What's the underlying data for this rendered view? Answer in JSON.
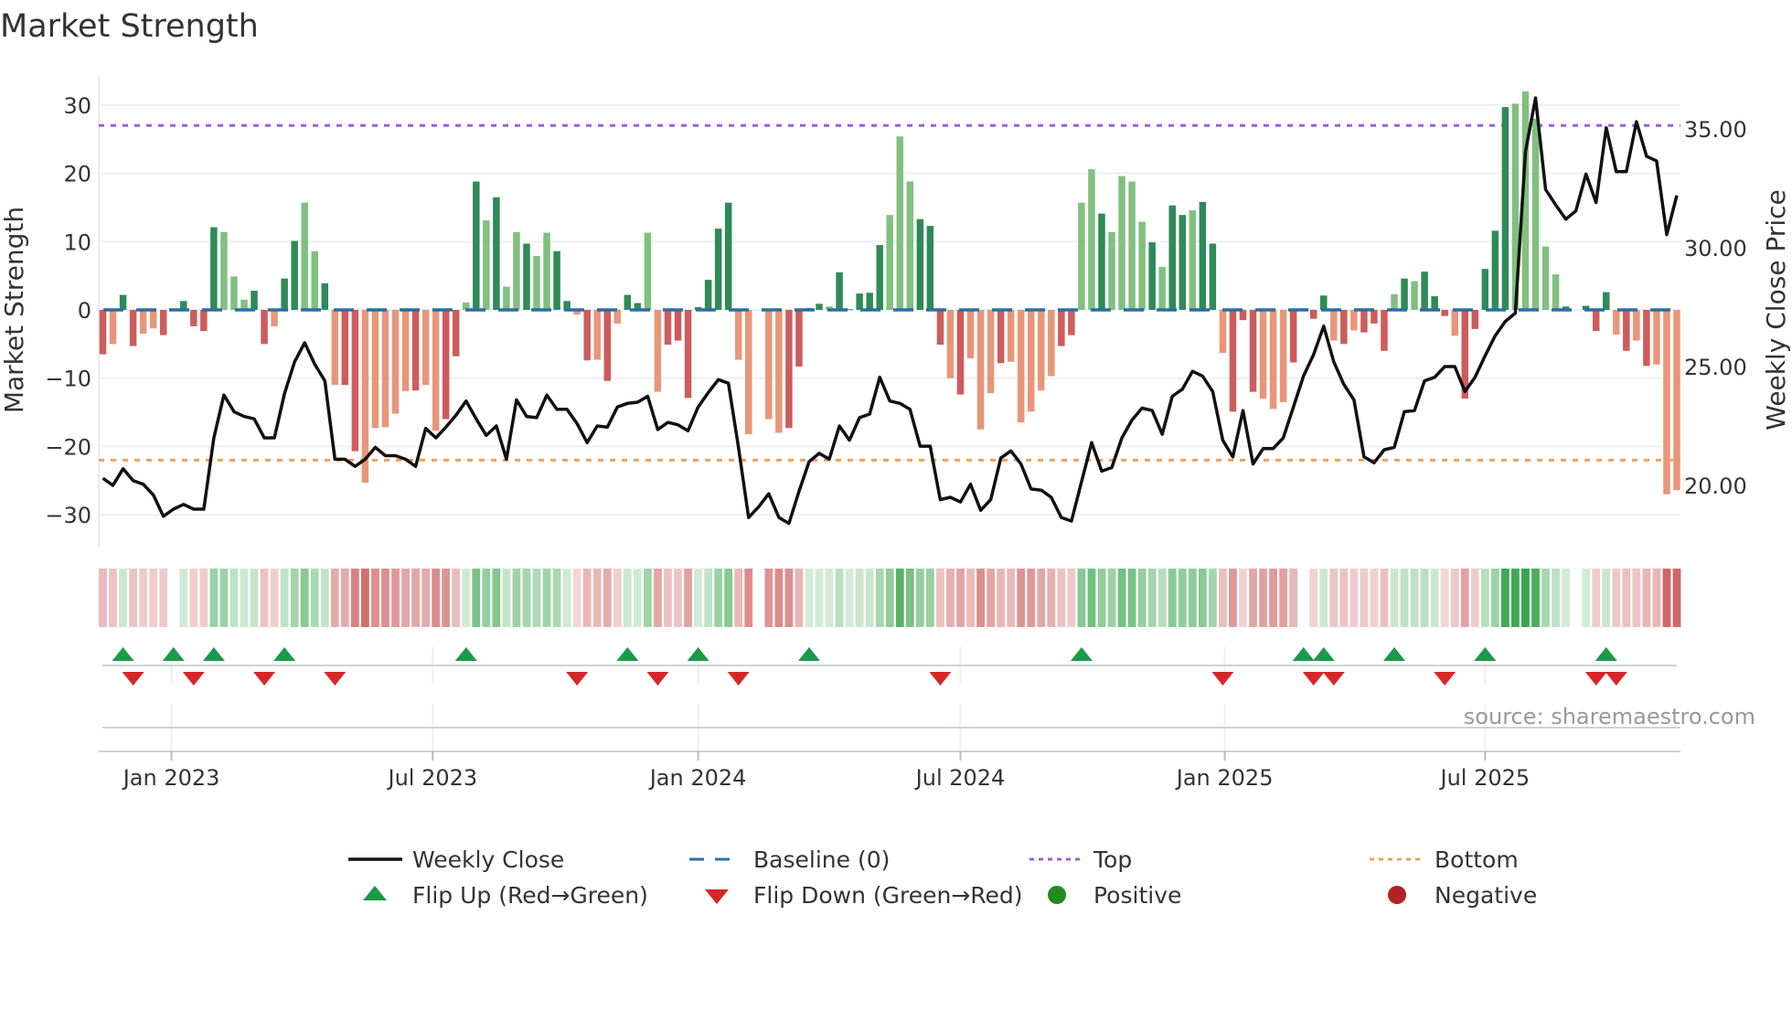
{
  "title": "Market Strength",
  "source": "source: sharemaestro.com",
  "colors": {
    "dark_green": "#2e8b57",
    "light_green": "#81c07f",
    "dark_red": "#cd5c5c",
    "light_red": "#e8967a",
    "line": "#111111",
    "baseline": "#2b6fa3",
    "top": "#9d5ce6",
    "bottom": "#f0a05a",
    "flip_up": "#1a9a4a",
    "flip_down": "#d62728",
    "positive": "#228b22",
    "negative": "#b22222"
  },
  "legend": {
    "weekly_close": "Weekly Close",
    "baseline": "Baseline (0)",
    "top": "Top",
    "bottom": "Bottom",
    "flip_up": "Flip Up (Red→Green)",
    "flip_down": "Flip Down (Green→Red)",
    "positive": "Positive",
    "negative": "Negative"
  },
  "chart_data": {
    "type": "bar",
    "title": "Market Strength",
    "ylabel": "Market Strength",
    "y2label": "Weekly Close Price",
    "ylim": [
      -35,
      35
    ],
    "y2lim": [
      17.9,
      36.9
    ],
    "yticks": [
      "30",
      "20",
      "10",
      "0",
      "−10",
      "−20",
      "−30"
    ],
    "ytick_values": [
      30,
      20,
      10,
      0,
      -10,
      -20,
      -30
    ],
    "y2ticks": [
      "35.00",
      "30.00",
      "25.00",
      "20.00"
    ],
    "y2tick_values": [
      35,
      30,
      25,
      20
    ],
    "xticks": [
      {
        "label": "Jan 2023",
        "week": 6.8
      },
      {
        "label": "Jul 2023",
        "week": 32.7
      },
      {
        "label": "Jan 2024",
        "week": 59.0
      },
      {
        "label": "Jul 2024",
        "week": 85.0
      },
      {
        "label": "Jan 2025",
        "week": 111.2
      },
      {
        "label": "Jul 2025",
        "week": 137.0
      }
    ],
    "top_level": 27,
    "bottom_level": -22,
    "baseline": 0,
    "strength": [
      -6.5,
      -5,
      2.2,
      -5.3,
      -3.5,
      -2.7,
      -3.7,
      0,
      1.3,
      -2.4,
      -3.1,
      12.1,
      11.4,
      4.9,
      1.5,
      2.8,
      -5,
      -2.4,
      4.6,
      10.1,
      15.7,
      8.6,
      3.9,
      -11,
      -11,
      -20.7,
      -25.3,
      -17.3,
      -17.2,
      -15.2,
      -11.9,
      -11.8,
      -11,
      -17.7,
      -16,
      -6.8,
      1.1,
      18.8,
      13.1,
      16.5,
      3.4,
      11.4,
      9.7,
      7.9,
      11.3,
      8.6,
      1.3,
      -0.7,
      -7.4,
      -7.3,
      -10.4,
      -2,
      2.2,
      1,
      11.3,
      -12,
      -5.1,
      -4.5,
      -12.9,
      0.4,
      4.4,
      11.9,
      15.7,
      -7.3,
      -18.2,
      0,
      -16,
      -18,
      -17.3,
      -8.3,
      0.3,
      0.9,
      0.5,
      5.5,
      0.1,
      2.4,
      2.5,
      9.5,
      13.9,
      25.4,
      18.8,
      13.3,
      12.3,
      -5.1,
      -10,
      -12.4,
      -7.1,
      -17.5,
      -12.2,
      -7.8,
      -7.6,
      -16.5,
      -14.9,
      -11.8,
      -9.7,
      -5.3,
      -3.7,
      15.7,
      20.6,
      14.1,
      11.4,
      19.6,
      18.8,
      12.9,
      9.9,
      6.3,
      15.3,
      13.9,
      14.6,
      15.8,
      9.7,
      -6.3,
      -14.9,
      -1.5,
      -12,
      -13,
      -14.5,
      -13.5,
      -7.7,
      0,
      -1.3,
      2.1,
      -4.5,
      -5,
      -3,
      -3.3,
      -2,
      -6,
      2.3,
      4.6,
      4.2,
      5.6,
      2,
      -0.9,
      -3.8,
      -13,
      -2.8,
      6,
      11.6,
      29.7,
      30.2,
      32,
      28,
      9.3,
      5.2,
      0.5,
      0,
      0.6,
      -3.1,
      2.6,
      -3.6,
      -6,
      -4.5,
      -8.2,
      -8,
      -27,
      -26.4
    ],
    "shade": "dlddlldnddddlllddlddlldlddllllldllddldldlldllddldldlddlldddddddnldllddldlddddd llldddldllldlllllddlldlllldlddlddldddllnddddldlddd ldldddlddd ddllllnddd ddldldl",
    "weekly_close": [
      20.3,
      20.0,
      20.7,
      20.2,
      20.05,
      19.6,
      18.7,
      19.0,
      19.2,
      19.0,
      19.0,
      22.0,
      23.8,
      23.1,
      22.9,
      22.8,
      22.0,
      22.0,
      23.85,
      25.2,
      26.0,
      25.1,
      24.4,
      21.1,
      21.1,
      20.8,
      21.1,
      21.6,
      21.25,
      21.25,
      21.1,
      20.8,
      22.4,
      22.0,
      22.45,
      22.95,
      23.55,
      22.8,
      22.1,
      22.5,
      21.1,
      23.6,
      22.9,
      22.85,
      23.8,
      23.2,
      23.2,
      22.6,
      21.8,
      22.5,
      22.45,
      23.3,
      23.45,
      23.5,
      23.75,
      22.35,
      22.65,
      22.55,
      22.3,
      23.3,
      23.9,
      24.45,
      24.3,
      21.6,
      18.65,
      19.1,
      19.65,
      18.65,
      18.4,
      19.75,
      21.0,
      21.35,
      21.1,
      22.5,
      21.9,
      22.85,
      23.0,
      24.55,
      23.55,
      23.45,
      23.2,
      21.65,
      21.65,
      19.4,
      19.5,
      19.3,
      20.05,
      18.95,
      19.4,
      21.15,
      21.45,
      20.9,
      19.85,
      19.8,
      19.5,
      18.65,
      18.5,
      20.15,
      21.8,
      20.6,
      20.75,
      22.0,
      22.75,
      23.25,
      23.15,
      22.15,
      23.75,
      24.05,
      24.8,
      24.6,
      23.95,
      21.9,
      21.2,
      23.15,
      20.9,
      21.55,
      21.55,
      22.0,
      23.3,
      24.6,
      25.5,
      26.7,
      25.2,
      24.25,
      23.6,
      21.2,
      20.95,
      21.5,
      21.6,
      23.1,
      23.15,
      24.4,
      24.55,
      25.0,
      25.0,
      23.95,
      24.55,
      25.45,
      26.3,
      26.9,
      27.25,
      34.05,
      36.3,
      32.45,
      31.8,
      31.2,
      31.55,
      33.1,
      31.9,
      35.05,
      33.2,
      33.2,
      35.3,
      33.85,
      33.65,
      30.55,
      32.2
    ],
    "flip_up_weeks": [
      2,
      7,
      11,
      18,
      36,
      52,
      59,
      70,
      97,
      119,
      121,
      128,
      137,
      149
    ],
    "flip_down_weeks": [
      3,
      9,
      16,
      23,
      47,
      55,
      63,
      83,
      111,
      120,
      122,
      133,
      148,
      150
    ]
  }
}
